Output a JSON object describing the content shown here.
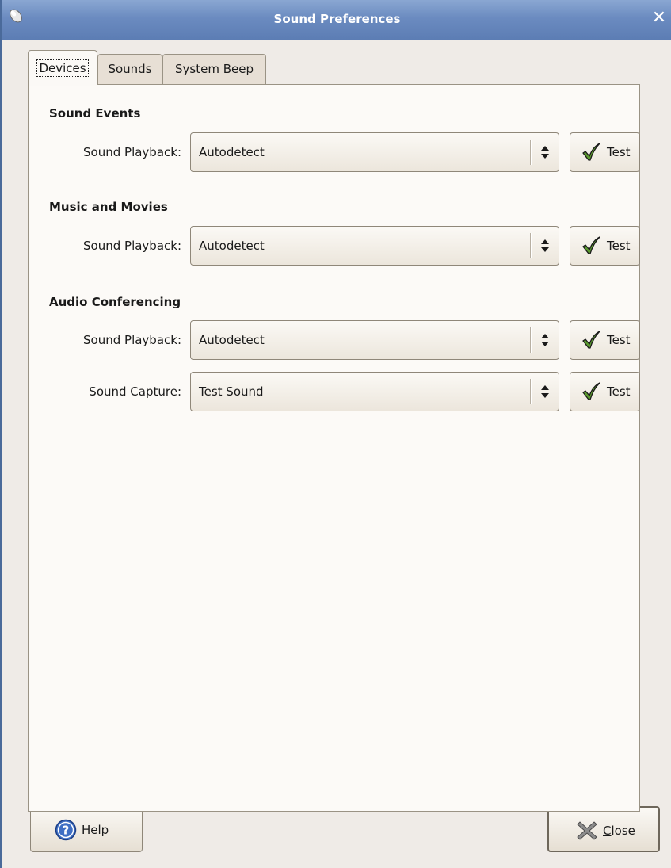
{
  "window": {
    "title": "Sound Preferences"
  },
  "tabs": [
    {
      "label": "Devices",
      "active": true
    },
    {
      "label": "Sounds",
      "active": false
    },
    {
      "label": "System Beep",
      "active": false
    }
  ],
  "sections": {
    "sound_events": {
      "heading": "Sound Events",
      "playback": {
        "label": "Sound Playback:",
        "value": "Autodetect",
        "test_label": "Test"
      }
    },
    "music_movies": {
      "heading": "Music and Movies",
      "playback": {
        "label": "Sound Playback:",
        "value": "Autodetect",
        "test_label": "Test"
      }
    },
    "audio_conferencing": {
      "heading": "Audio Conferencing",
      "playback": {
        "label": "Sound Playback:",
        "value": "Autodetect",
        "test_label": "Test"
      },
      "capture": {
        "label": "Sound Capture:",
        "value": "Test Sound",
        "test_label": "Test"
      }
    }
  },
  "buttons": {
    "help": {
      "mnemonic": "H",
      "rest": "elp",
      "icon": "help-icon"
    },
    "close": {
      "mnemonic": "C",
      "rest": "lose",
      "icon": "close-icon"
    }
  },
  "colors": {
    "titlebar": "#6b8bc0",
    "window_bg": "#efebe7",
    "panel_bg": "#fcfaf7",
    "check_green": "#4a8a2a"
  }
}
